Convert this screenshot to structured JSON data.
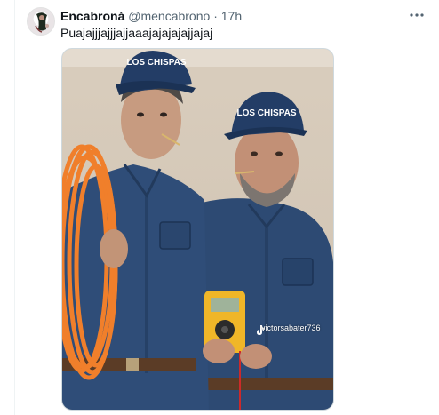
{
  "tweet": {
    "display_name": "Encabroná",
    "handle": "@mencabrono",
    "separator": "·",
    "time": "17h",
    "text": "Puajajjjajjjajjaaajajajajajjajaj"
  },
  "media": {
    "cap_text_left": "LOS CHISPAS",
    "cap_text_right": "LOS CHISPAS",
    "watermark": "victorsabater736",
    "icons": {
      "more": "more-horizontal-icon",
      "tiktok": "tiktok-icon"
    }
  },
  "colors": {
    "uniform": "#2d4a73",
    "cap": "#233d66",
    "cable": "#f07f2b",
    "multimeter": "#f0b628"
  }
}
